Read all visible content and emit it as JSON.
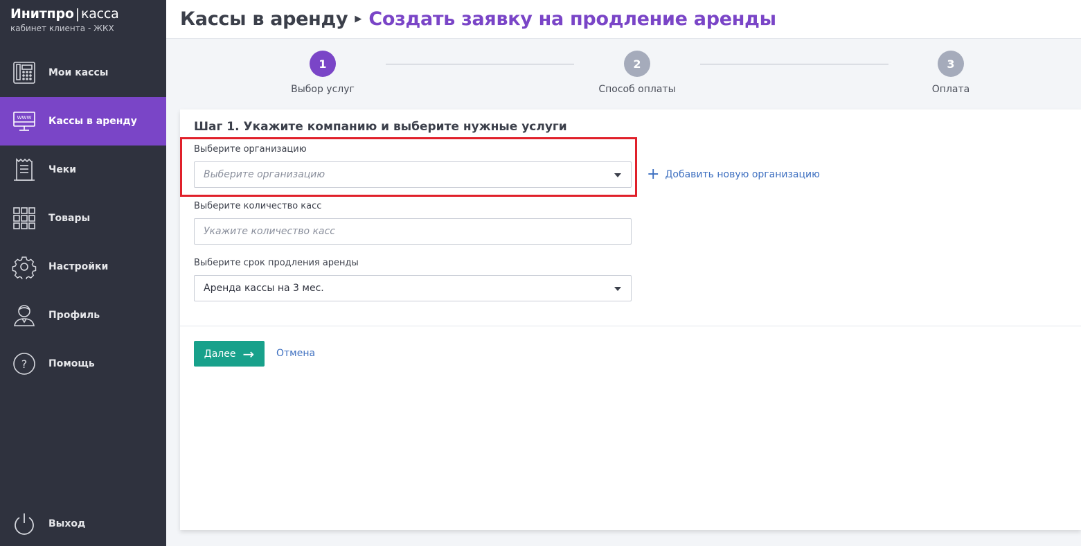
{
  "brand": {
    "name": "Инитпро",
    "product": "касса",
    "subtitle": "кабинет клиента - ЖКХ"
  },
  "sidebar": {
    "items": [
      {
        "label": "Мои кассы",
        "icon": "cash-register-icon"
      },
      {
        "label": "Кассы в аренду",
        "icon": "www-monitor-icon",
        "active": true
      },
      {
        "label": "Чеки",
        "icon": "receipt-icon"
      },
      {
        "label": "Товары",
        "icon": "grid-icon"
      },
      {
        "label": "Настройки",
        "icon": "gear-icon"
      },
      {
        "label": "Профиль",
        "icon": "user-icon"
      },
      {
        "label": "Помощь",
        "icon": "help-icon"
      }
    ],
    "logout": {
      "label": "Выход",
      "icon": "power-icon"
    }
  },
  "header": {
    "breadcrumb_parent": "Кассы в аренду",
    "breadcrumb_current": "Создать заявку на продление аренды"
  },
  "stepper": {
    "steps": [
      {
        "number": "1",
        "label": "Выбор услуг",
        "active": true
      },
      {
        "number": "2",
        "label": "Способ оплаты",
        "active": false
      },
      {
        "number": "3",
        "label": "Оплата",
        "active": false
      }
    ]
  },
  "form": {
    "title": "Шаг 1. Укажите компанию и выберите нужные услуги",
    "organization": {
      "label": "Выберите организацию",
      "placeholder": "Выберите организацию",
      "value": ""
    },
    "add_organization_label": "Добавить новую организацию",
    "quantity": {
      "label": "Выберите количество касс",
      "placeholder": "Укажите количество касс",
      "value": ""
    },
    "term": {
      "label": "Выберите срок продления аренды",
      "value": "Аренда кассы на 3 мес."
    },
    "next_label": "Далее",
    "cancel_label": "Отмена"
  },
  "colors": {
    "sidebar_bg": "#2f323e",
    "accent": "#7a45c7",
    "primary_button": "#18a18b",
    "link": "#3d6fc0",
    "highlight": "#e0202a"
  }
}
